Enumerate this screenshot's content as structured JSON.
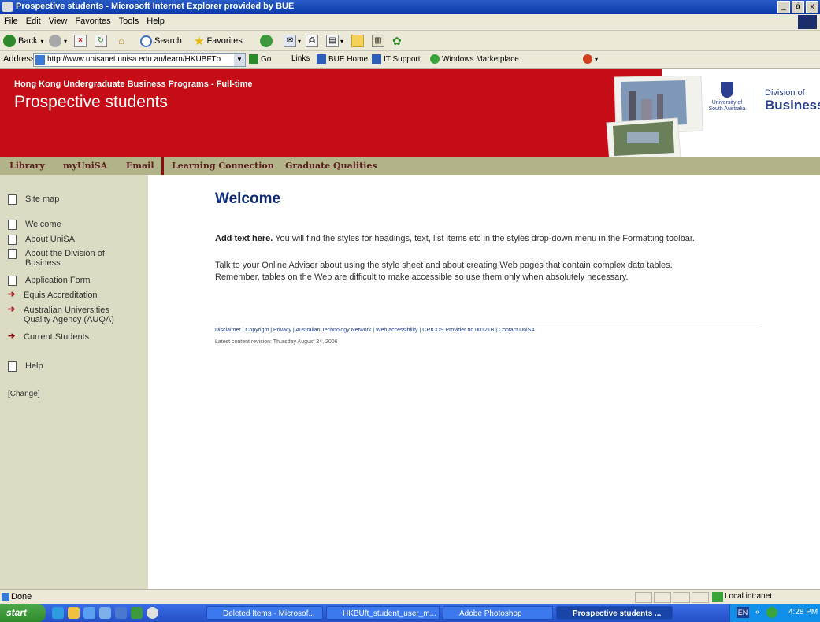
{
  "window": {
    "title": "Prospective students - Microsoft Internet Explorer provided by BUE",
    "controls": [
      "_",
      "ȧ",
      "x"
    ]
  },
  "menu": [
    "File",
    "Edit",
    "View",
    "Favorites",
    "Tools",
    "Help"
  ],
  "toolbar": {
    "back_label": "Back",
    "search_label": "Search",
    "favorites_label": "Favorites"
  },
  "address": {
    "label": "Address",
    "url": "http://www.unisanet.unisa.edu.au/learn/HKUBFTp",
    "go_label": "Go",
    "links_label": "Links",
    "links": [
      "BUE Home",
      "IT Support",
      "Windows Marketplace"
    ]
  },
  "banner": {
    "program": "Hong Kong Undergraduate Business Programs - Full-time",
    "heading": "Prospective students",
    "logo_lines": [
      "University of",
      "South Australia"
    ],
    "division_line1": "Division of",
    "division_line2": "Business"
  },
  "nav": [
    "Library",
    "myUniSA",
    "Email",
    "Learning Connection",
    "Graduate Qualities"
  ],
  "sidebar": {
    "site_map": "Site map",
    "items": [
      {
        "label": "Welcome",
        "icon": "page-icon"
      },
      {
        "label": "About UniSA",
        "icon": "page-icon"
      },
      {
        "label": "About the Division of Business",
        "icon": "page-icon"
      },
      {
        "label": "Application Form",
        "icon": "page-icon"
      },
      {
        "label": "Equis Accreditation",
        "icon": "arrow-page-icon"
      },
      {
        "label": "Australian Universities Quality Agency (AUQA)",
        "icon": "arrow-page-icon"
      },
      {
        "label": "Current Students",
        "icon": "arrow-page-icon"
      }
    ],
    "help": "Help",
    "change": "[Change]"
  },
  "main": {
    "title": "Welcome",
    "para1_bold": "Add text here.",
    "para1_rest": " You will find the styles for headings, text, list items etc in the styles drop-down menu in the Formatting toolbar.",
    "para2_line1": "Talk to your Online Adviser about using the style sheet and about creating Web pages that contain complex data tables.",
    "para2_line2": "Remember, tables on the Web are difficult to make accessible so use them only when absolutely necessary.",
    "footer_links": "Disclaimer | Copyright | Privacy | Australian Technology Network | Web accessibility | CRICOS Provider no 00121B | Contact UniSA",
    "revision": "Latest content revision: Thursday August 24, 2006"
  },
  "status": {
    "text": "Done",
    "zone": "Local intranet"
  },
  "taskbar": {
    "start": "start",
    "buttons": [
      "Deleted Items - Microsof...",
      "HKBUft_student_user_m...",
      "Adobe Photoshop",
      "Prospective students ..."
    ],
    "lang": "EN",
    "time": "4:28 PM"
  },
  "colors": {
    "banner_red": "#c60d17",
    "nav_olive": "#b3b38a",
    "sidebar_bg": "#dcdcc4",
    "title_blue": "#0f2a78"
  }
}
